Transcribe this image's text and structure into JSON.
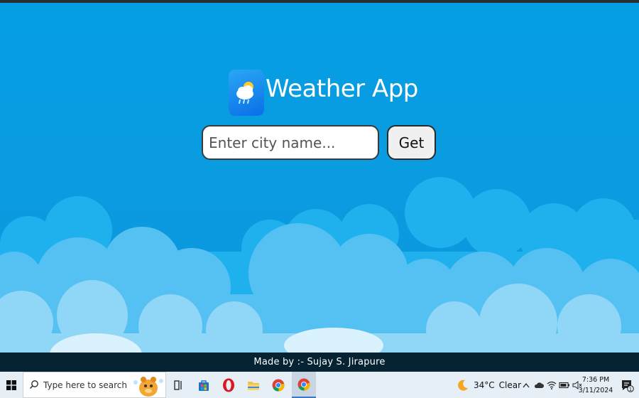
{
  "app": {
    "title": "Weather App",
    "logo_icon": "weather-cloud-sun-rain-icon"
  },
  "search": {
    "placeholder": "Enter city name...",
    "value": ""
  },
  "actions": {
    "get_label": "Get"
  },
  "footer": {
    "text": "Made by :- Sujay S. Jirapure"
  },
  "taskbar": {
    "start_icon": "windows-start-icon",
    "search_placeholder": "Type here to search",
    "apps": [
      {
        "name": "task-view",
        "icon": "task-view-icon"
      },
      {
        "name": "microsoft-store",
        "icon": "store-icon"
      },
      {
        "name": "opera",
        "icon": "opera-icon"
      },
      {
        "name": "file-explorer",
        "icon": "folder-icon"
      },
      {
        "name": "chrome",
        "icon": "chrome-icon"
      },
      {
        "name": "chrome-active",
        "icon": "chrome-icon",
        "active": true
      }
    ],
    "weather": {
      "temperature": "34°C",
      "condition": "Clear"
    },
    "clock": {
      "time": "7:36 PM",
      "date": "3/11/2024"
    },
    "notifications_count": "1"
  },
  "colors": {
    "sky": "#049ee3",
    "footer_bg": "#062334",
    "taskbar_bg": "#e6eef6"
  }
}
